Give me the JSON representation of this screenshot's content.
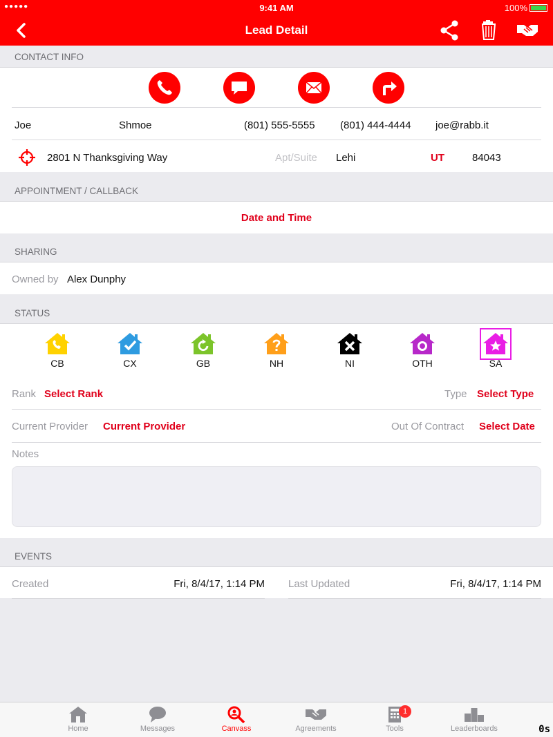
{
  "status_bar": {
    "signal": "●●●●● ",
    "time": "9:41 AM",
    "battery": "100%"
  },
  "navbar": {
    "title": "Lead Detail",
    "icons": [
      "back-icon",
      "share-icon",
      "trash-icon",
      "handshake-icon"
    ]
  },
  "sections": {
    "contact": "CONTACT INFO",
    "appointment": "APPOINTMENT / CALLBACK",
    "sharing": "SHARING",
    "status": "STATUS",
    "events": "EVENTS"
  },
  "contact": {
    "actions": [
      "phone-icon",
      "message-icon",
      "mail-icon",
      "directions-icon"
    ],
    "first_name": "Joe",
    "last_name": "Shmoe",
    "phone1": "(801) 555-5555",
    "phone2": "(801) 444-4444",
    "email": "joe@rabb.it",
    "address": "2801 N Thanksgiving Way",
    "apt_placeholder": "Apt/Suite",
    "city": "Lehi",
    "state": "UT",
    "zip": "84043"
  },
  "appointment": {
    "value": "Date and Time"
  },
  "sharing": {
    "owned_by_label": "Owned by",
    "owner": "Alex Dunphy"
  },
  "status": {
    "items": [
      {
        "code": "CB",
        "color": "#ffd200",
        "icon": "house-phone-icon"
      },
      {
        "code": "CX",
        "color": "#2e9be0",
        "icon": "house-check-icon"
      },
      {
        "code": "GB",
        "color": "#7cc42a",
        "icon": "house-refresh-icon"
      },
      {
        "code": "NH",
        "color": "#ff9f1a",
        "icon": "house-question-icon"
      },
      {
        "code": "NI",
        "color": "#000000",
        "icon": "house-x-icon"
      },
      {
        "code": "OTH",
        "color": "#b728c9",
        "icon": "house-circle-icon"
      },
      {
        "code": "SA",
        "color": "#e91ee5",
        "icon": "house-star-icon",
        "selected": true
      }
    ],
    "rank_label": "Rank",
    "rank_value": "Select Rank",
    "type_label": "Type",
    "type_value": "Select Type",
    "provider_label": "Current Provider",
    "provider_value": "Current Provider",
    "contract_label": "Out Of Contract",
    "contract_value": "Select Date",
    "notes_label": "Notes",
    "notes_value": ""
  },
  "events": {
    "created_label": "Created",
    "created_value": "Fri, 8/4/17, 1:14 PM",
    "updated_label": "Last Updated",
    "updated_value": "Fri, 8/4/17, 1:14 PM"
  },
  "tabs": [
    {
      "label": "Home",
      "icon": "home-icon"
    },
    {
      "label": "Messages",
      "icon": "messages-icon"
    },
    {
      "label": "Canvass",
      "icon": "canvass-icon",
      "active": true
    },
    {
      "label": "Agreements",
      "icon": "agreements-icon"
    },
    {
      "label": "Tools",
      "icon": "tools-icon",
      "badge": "1"
    },
    {
      "label": "Leaderboards",
      "icon": "leaderboards-icon"
    }
  ],
  "corner_mark": "0s",
  "colors": {
    "brand": "#ff0000",
    "accent_text": "#e0001b",
    "selected": "#e91ee5"
  }
}
